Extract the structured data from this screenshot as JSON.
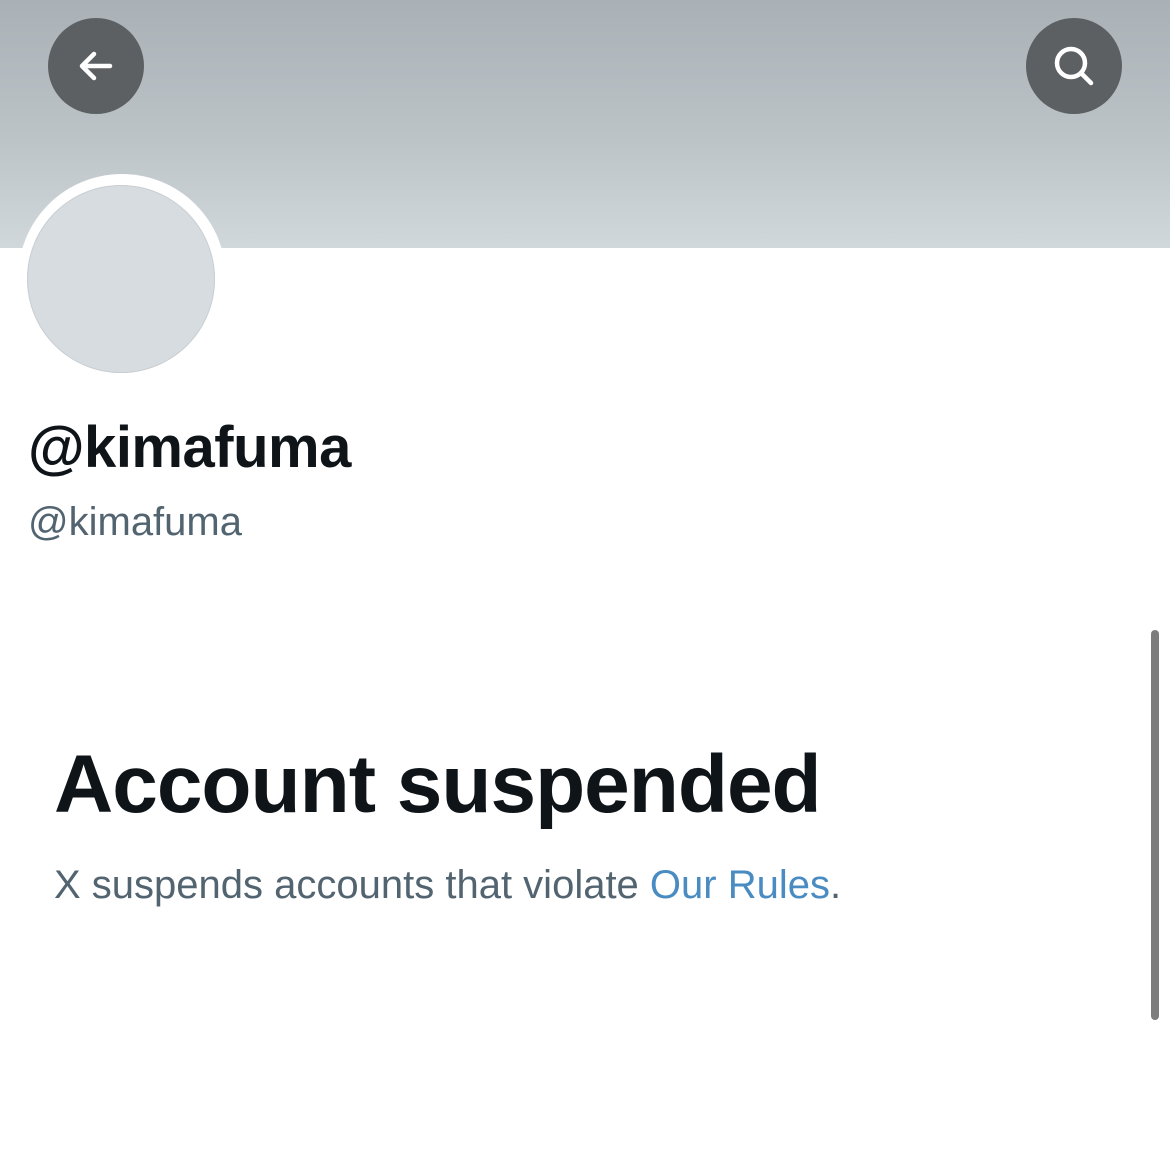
{
  "header": {
    "back_icon": "arrow-left-icon",
    "search_icon": "search-icon",
    "button_color": "#5d6063"
  },
  "profile": {
    "display_name": "@kimafuma",
    "handle": "@kimafuma",
    "avatar_color": "#d6dcdf"
  },
  "suspension": {
    "title": "Account suspended",
    "description_prefix": "X suspends accounts that violate ",
    "rules_link": "Our Rules",
    "description_suffix": ".",
    "link_color": "#4a8cc2"
  }
}
